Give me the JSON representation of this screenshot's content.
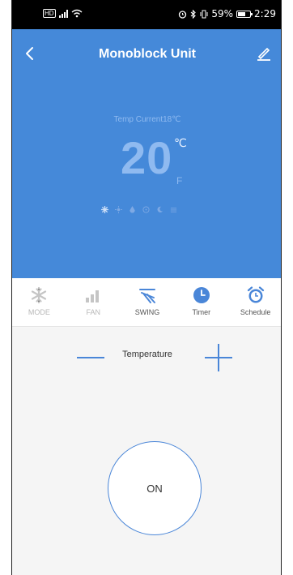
{
  "status_bar": {
    "left_icons": [
      "hd-icon",
      "signal-icon",
      "wifi-icon"
    ],
    "right_text": "59%",
    "time": "2:29"
  },
  "header": {
    "title": "Monoblock Unit",
    "temp_current": "Temp Current18℃",
    "set_temperature": "20",
    "unit_c": "℃",
    "unit_f": "F",
    "mode_icons": [
      "snowflake-icon",
      "sun-icon",
      "drop-icon",
      "fan-icon",
      "moon-icon",
      "swing-icon"
    ],
    "accent_color": "#4589d9"
  },
  "functions": [
    {
      "label": "MODE",
      "icon": "snowflake-icon",
      "active": false
    },
    {
      "label": "FAN",
      "icon": "fan-speed-icon",
      "active": false
    },
    {
      "label": "SWING",
      "icon": "swing-icon",
      "active": true
    },
    {
      "label": "Timer",
      "icon": "clock-icon",
      "active": true
    },
    {
      "label": "Schedule",
      "icon": "alarm-icon",
      "active": true
    }
  ],
  "control": {
    "temperature_label": "Temperature",
    "power_label": "ON"
  }
}
